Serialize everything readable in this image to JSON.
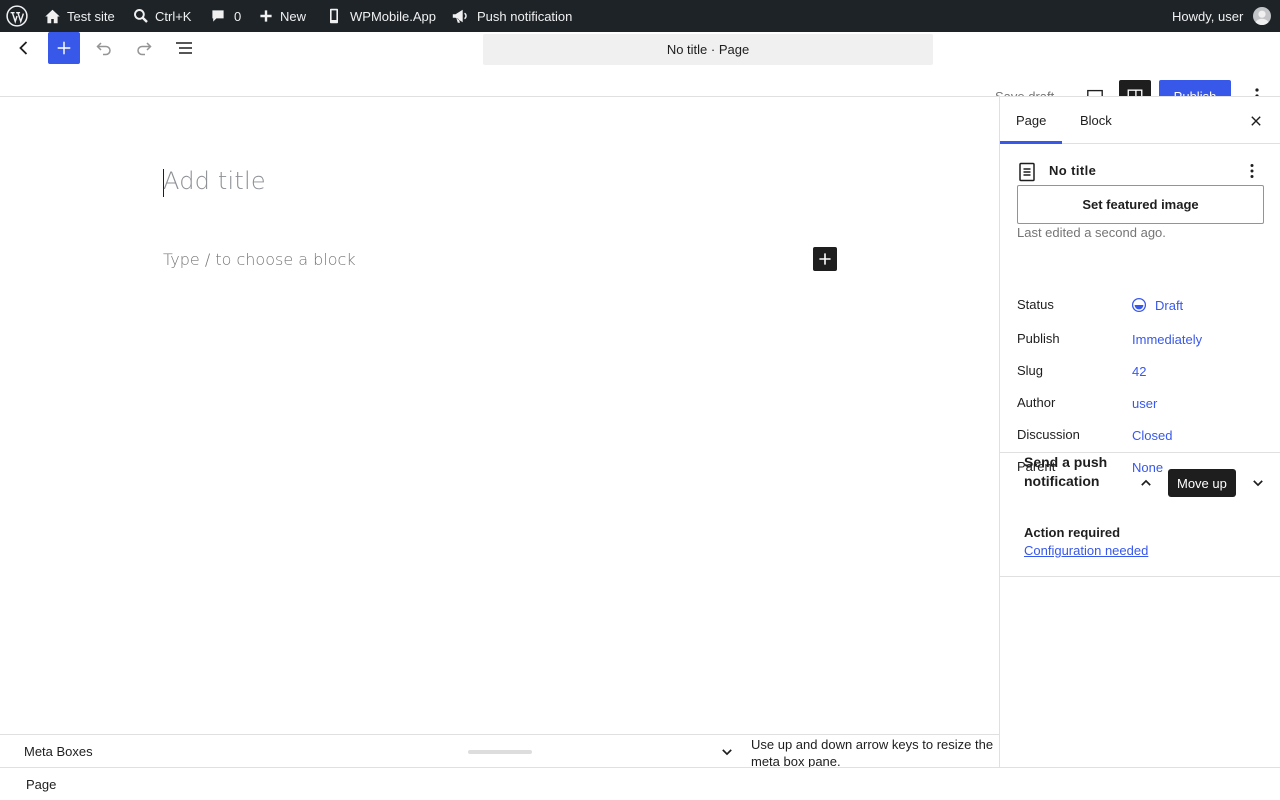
{
  "admin_bar": {
    "site_name": "Test site",
    "search_shortcut": "Ctrl+K",
    "comments_count": "0",
    "new_label": "New",
    "wpmobile_label": "WPMobile.App",
    "push_label": "Push notification",
    "greeting": "Howdy, user"
  },
  "header": {
    "doc_bar": "No title · Page",
    "save_draft": "Save draft",
    "publish": "Publish"
  },
  "canvas": {
    "title_placeholder": "Add title",
    "block_placeholder": "Type / to choose a block"
  },
  "meta_bar": {
    "title": "Meta Boxes",
    "help": "Use up and down arrow keys to resize the meta box pane."
  },
  "footer": {
    "breadcrumb": "Page"
  },
  "sidebar": {
    "tabs": [
      {
        "label": "Page"
      },
      {
        "label": "Block"
      }
    ],
    "doc_title": "No title",
    "featured_image_button": "Set featured image",
    "last_edited": "Last edited a second ago.",
    "properties": [
      {
        "label": "Status",
        "value": "Draft"
      },
      {
        "label": "Publish",
        "value": "Immediately"
      },
      {
        "label": "Slug",
        "value": "42"
      },
      {
        "label": "Author",
        "value": "user"
      },
      {
        "label": "Discussion",
        "value": "Closed"
      },
      {
        "label": "Parent",
        "value": "None"
      }
    ],
    "push_panel": {
      "title": "Send a push notification",
      "tooltip": "Move up",
      "action_required": "Action required",
      "config_link": "Configuration needed"
    }
  },
  "colors": {
    "accent": "#3858e9",
    "admin_bar_bg": "#1d2327",
    "text": "#1e1e1e"
  }
}
